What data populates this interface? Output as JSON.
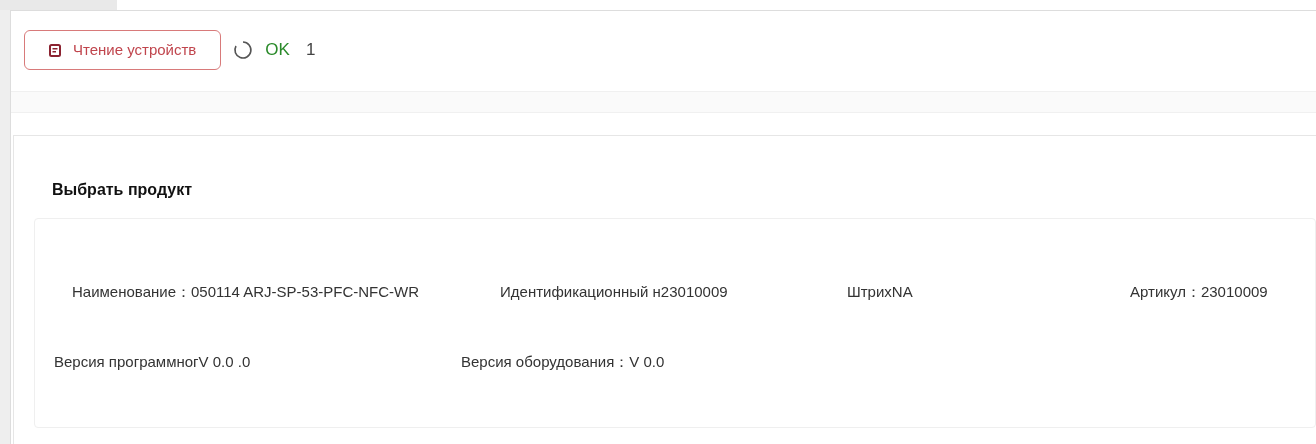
{
  "toolbar": {
    "read_button": "Чтение устройств",
    "status": "OK",
    "count": "1"
  },
  "product": {
    "title": "Выбрать продукт",
    "row_1": [
      {
        "label": "Наименование：",
        "value": "050114 ARJ-SP-53-PFC-NFC-WR"
      },
      {
        "label": "Идентификационный н",
        "value": "23010009"
      },
      {
        "label": "Штрих",
        "value": "NA"
      },
      {
        "label": "Артикул：",
        "value": "23010009"
      }
    ],
    "row_2": [
      {
        "label": "Версия программног",
        "value": "V 0.0 .0"
      },
      {
        "label": "Версия оборудования：",
        "value": "V 0.0"
      }
    ]
  }
}
